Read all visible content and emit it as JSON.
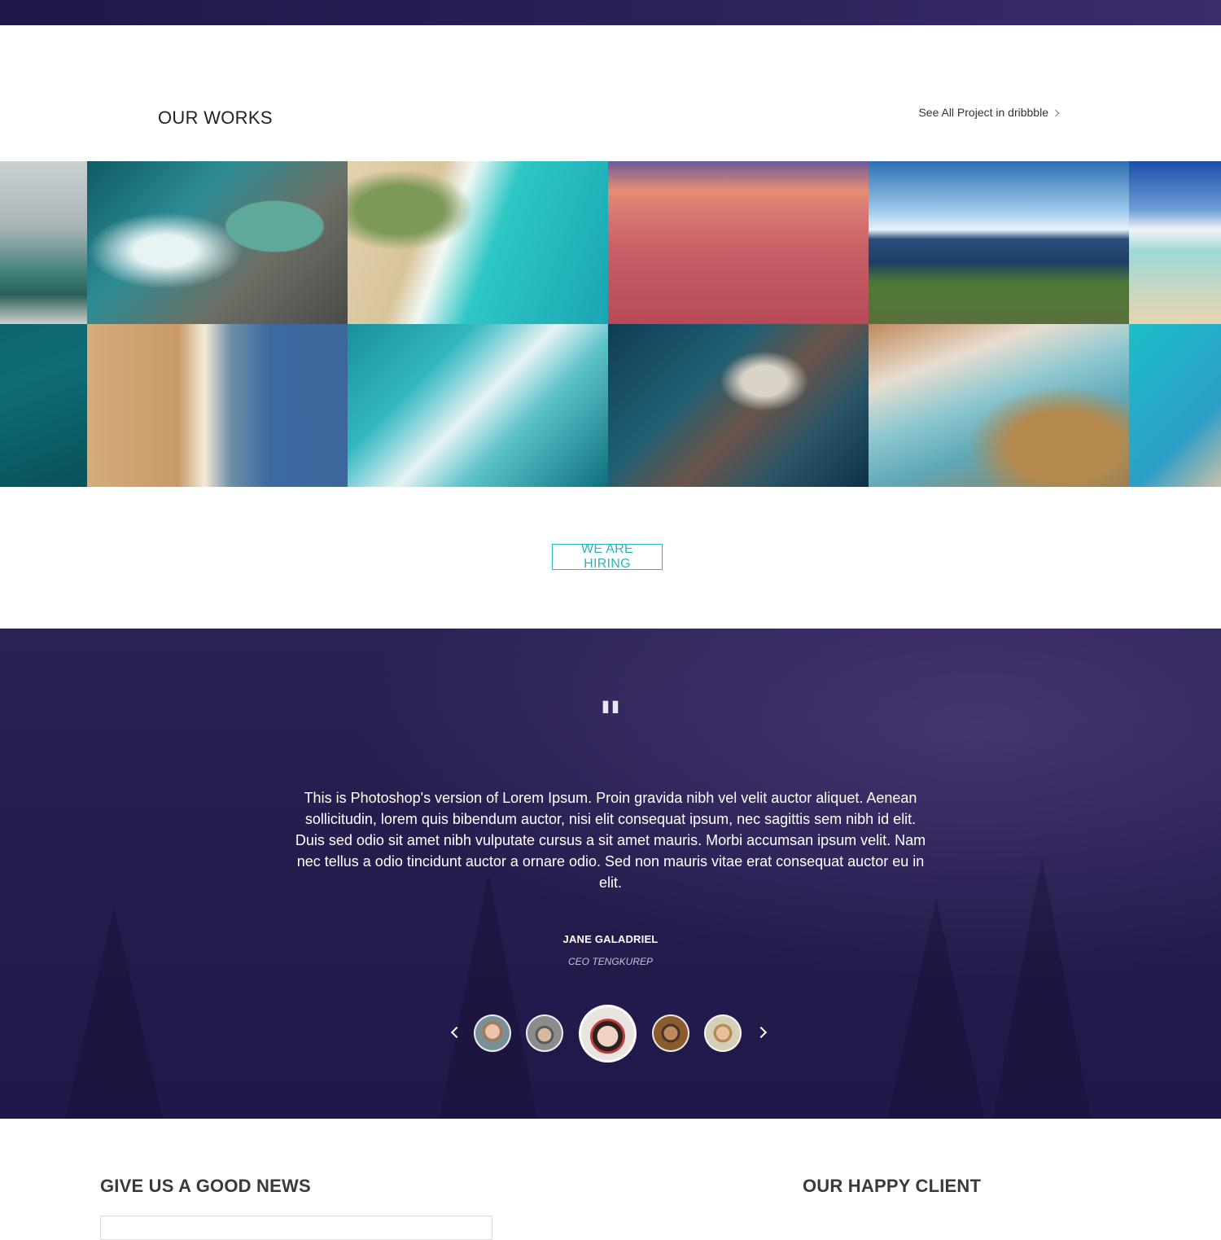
{
  "works": {
    "title": "OUR WORKS",
    "see_all_label": "See All Project in dribbble"
  },
  "gallery": {
    "images": [
      "seascape-horizon-image",
      "aerial-rock-pool-image",
      "aerial-turquoise-coast-image",
      "pink-sunset-beach-image",
      "coastal-cliff-sky-image",
      "tropical-shore-image",
      "deep-teal-water-image",
      "aerial-sand-beach-image",
      "aerial-waves-image",
      "aerial-rocky-shore-image",
      "aerial-lagoon-image",
      "aerial-breakwater-image"
    ]
  },
  "hiring": {
    "label": "WE ARE HIRING"
  },
  "testimonial": {
    "quote_mark": "\"",
    "text": "This is Photoshop's version of Lorem Ipsum. Proin gravida nibh vel velit auctor aliquet. Aenean sollicitudin, lorem quis bibendum auctor, nisi elit consequat ipsum, nec sagittis sem nibh id elit. Duis sed odio sit amet nibh vulputate cursus a sit amet mauris. Morbi accumsan ipsum velit. Nam nec tellus a odio tincidunt auctor a ornare odio. Sed non mauris vitae erat consequat auctor eu in elit.",
    "name": "JANE GALADRIEL",
    "role": "CEO TENGKUREP",
    "active_index": 2,
    "avatar_count": 5
  },
  "footer": {
    "news_title": "GIVE US A GOOD NEWS",
    "client_title": "OUR HAPPY CLIENT"
  },
  "colors": {
    "accent": "#2bb3c0",
    "testimonial_bg": "#261d4e"
  }
}
